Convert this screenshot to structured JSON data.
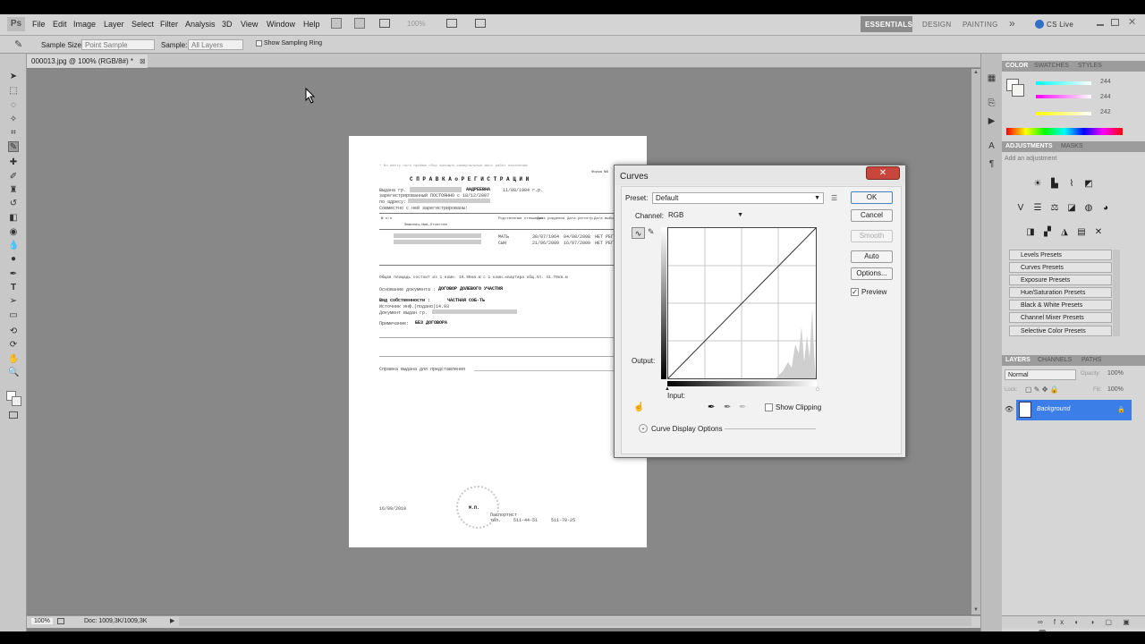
{
  "app": {
    "logo": "Ps"
  },
  "menu": [
    "File",
    "Edit",
    "Image",
    "Layer",
    "Select",
    "Filter",
    "Analysis",
    "3D",
    "View",
    "Window",
    "Help"
  ],
  "zoom_field": "100%",
  "workspaces": {
    "essentials": "ESSENTIALS",
    "design": "DESIGN",
    "painting": "PAINTING",
    "more": "»",
    "cslive": "CS Live"
  },
  "options": {
    "sample_size_label": "Sample Size:",
    "sample_size": "Point Sample",
    "sample_label": "Sample:",
    "sample": "All Layers",
    "show_ring": "Show Sampling Ring"
  },
  "document": {
    "tab": "000013.jpg @ 100% (RGB/8#) *",
    "close": "⊠"
  },
  "status": {
    "zoom": "100%",
    "doc": "Doc: 1009,3K/1009,3K"
  },
  "paper": {
    "top_note": "* Ко месту ного приёма   сбор жилищно-коммунальные мисс работ населению",
    "form_no": "Форма №9",
    "title": "С П Р А В К А   о   Р Е Г И С Т Р А Ц И И",
    "l1": "Выдана гр.",
    "name": "АНДРЕЕВНА",
    "l1b": "11/08/1984 г.р.",
    "l2": "зарегистрированный ПОСТОЯННО с 10/12/2007",
    "l3": "по адресу:",
    "l4": "Совместно с ней зарегистрированы:",
    "th_no": "№ п/п",
    "th_name": "Фамилия,Имя,Отчество",
    "th_rel": "Родственные отношения",
    "th_dob": "Дата рождения",
    "th_reg": "Дата регистр.",
    "th_reason": "Дата выбытия",
    "r1_rel": "МАТЬ",
    "r1_dob": "30/07/1964",
    "r1_reg": "04/08/2008",
    "r1_out": "НЕТ РЕГ",
    "r2_rel": "СЫН",
    "r2_dob": "21/06/2009",
    "r2_reg": "16/07/2009",
    "r2_out": "НЕТ РЕГ",
    "area_text": "Общая площадь состоит из 1 комн. 16.90кв.м с 1 комн.квартира общ.пл. 41.70кв.м",
    "basis_label": "Основание документа :",
    "basis": "ДОГОВОР ДОЛЕВОГО УЧАСТИЯ",
    "own_label": "Вид собственности :",
    "own": "ЧАСТНАЯ СОБ-ТЬ",
    "src": "Источник инф.(подано)14.93",
    "issued": "Документ выдан гр.",
    "note_label": "Примечание:",
    "note": "БЕЗ ДОГОВОРА",
    "purpose": "Справка выдана для представления",
    "date": "16/09/2010",
    "signature": "М.П.",
    "pass_lbl": "Паспортист",
    "tel": "тел.",
    "tel1": "511-44-51",
    "tel2": "511-70-25"
  },
  "curves": {
    "title": "Curves",
    "preset_label": "Preset:",
    "preset": "Default",
    "channel_label": "Channel:",
    "channel": "RGB",
    "ok": "OK",
    "cancel": "Cancel",
    "smooth": "Smooth",
    "auto": "Auto",
    "options": "Options...",
    "preview": "Preview",
    "output": "Output:",
    "input": "Input:",
    "show_clipping": "Show Clipping",
    "display_options": "Curve Display Options"
  },
  "color_panel": {
    "tabs": [
      "COLOR",
      "SWATCHES",
      "STYLES"
    ],
    "values": [
      "244",
      "244",
      "242"
    ],
    "spectrum": [
      "#ff0000",
      "#ffff00",
      "#00ff00",
      "#00ffff",
      "#0000ff",
      "#ff00ff",
      "#ff0000"
    ]
  },
  "adjustments": {
    "tabs": [
      "ADJUSTMENTS",
      "MASKS"
    ],
    "hint": "Add an adjustment",
    "presets": [
      "Levels Presets",
      "Curves Presets",
      "Exposure Presets",
      "Hue/Saturation Presets",
      "Black & White Presets",
      "Channel Mixer Presets",
      "Selective Color Presets"
    ]
  },
  "layers": {
    "tabs": [
      "LAYERS",
      "CHANNELS",
      "PATHS"
    ],
    "blend": "Normal",
    "opacity_label": "Opacity:",
    "opacity": "100%",
    "lock_label": "Lock:",
    "fill_label": "Fill:",
    "fill": "100%",
    "layer_name": "Background",
    "accent": "#3b7ee8"
  }
}
